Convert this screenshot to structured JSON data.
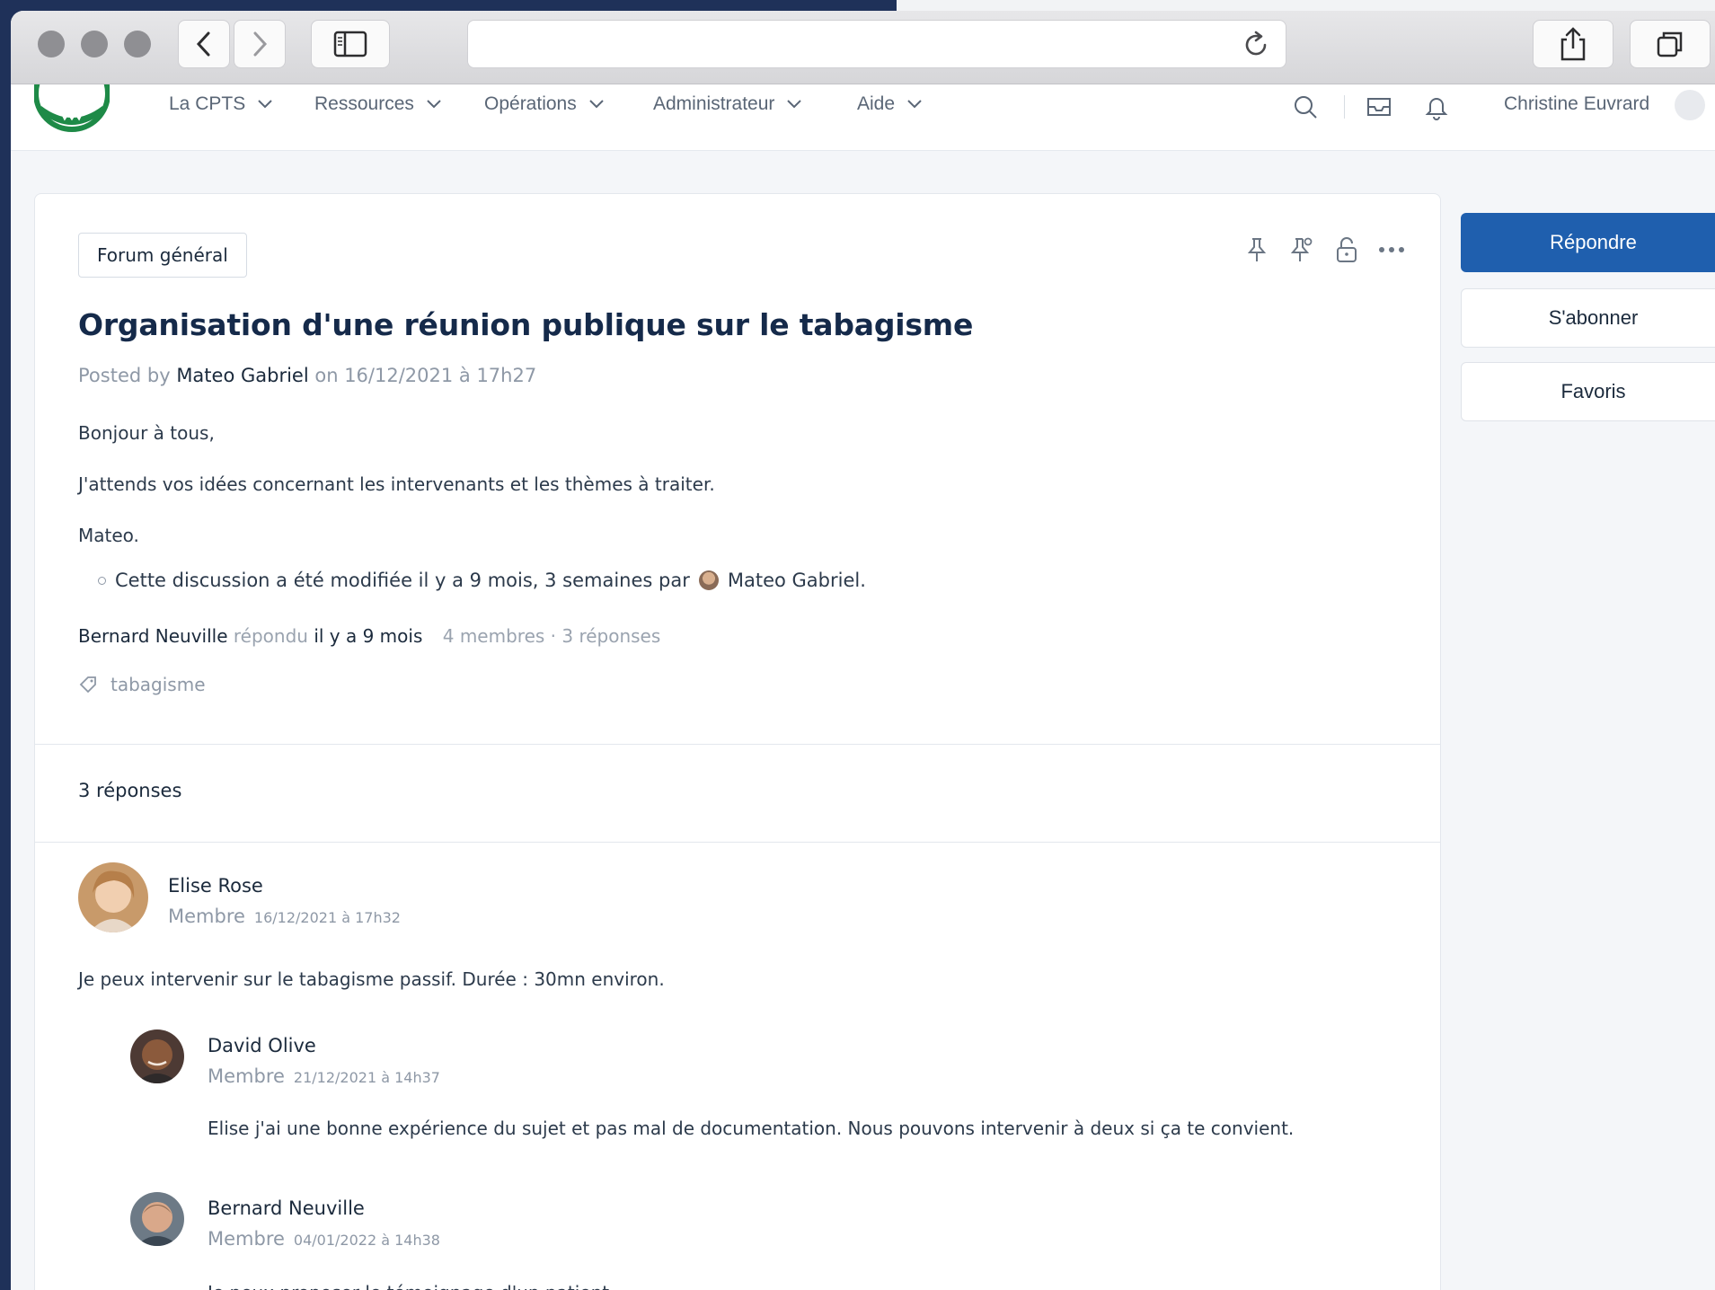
{
  "app": {
    "nav": [
      {
        "label": "La CPTS"
      },
      {
        "label": "Ressources"
      },
      {
        "label": "Opérations"
      },
      {
        "label": "Administrateur"
      },
      {
        "label": "Aide"
      }
    ],
    "user_name": "Christine Euvrard"
  },
  "post": {
    "forum": "Forum général",
    "title": "Organisation d'une réunion publique sur le tabagisme",
    "posted_by_prefix": "Posted by",
    "author": "Mateo Gabriel",
    "date": "on 16/12/2021 à 17h27",
    "body": [
      "Bonjour à tous,",
      "J'attends vos idées concernant les intervenants et les thèmes à traiter.",
      "Mateo."
    ],
    "edited_text": "Cette discussion a été modifiée il y a 9 mois, 3 semaines par",
    "edited_by": "Mateo Gabriel.",
    "last_reply_author": "Bernard Neuville",
    "last_reply_verb": "répondu",
    "last_reply_time": "il y a 9 mois",
    "stats": "4 membres · 3  réponses",
    "tag": "tabagisme"
  },
  "replies_header": "3  réponses",
  "comments": [
    {
      "name": "Elise Rose",
      "role": "Membre",
      "date": "16/12/2021 à 17h32",
      "text": "Je peux intervenir sur le tabagisme passif. Durée : 30mn environ."
    },
    {
      "name": "David Olive",
      "role": "Membre",
      "date": "21/12/2021 à 14h37",
      "text": "Elise j'ai une bonne expérience du sujet et pas mal de documentation. Nous pouvons intervenir à deux si ça te convient."
    },
    {
      "name": "Bernard Neuville",
      "role": "Membre",
      "date": "04/01/2022 à 14h38",
      "text": "Je peux proposer le témoignage d'un patient."
    }
  ],
  "sidebar": {
    "reply_label": "Répondre",
    "subscribe_label": "S'abonner",
    "favorites_label": "Favoris"
  },
  "colors": {
    "primary": "#1f5fae",
    "title": "#152a4a",
    "muted": "#8e98a6",
    "logo_green": "#1e8a47"
  }
}
